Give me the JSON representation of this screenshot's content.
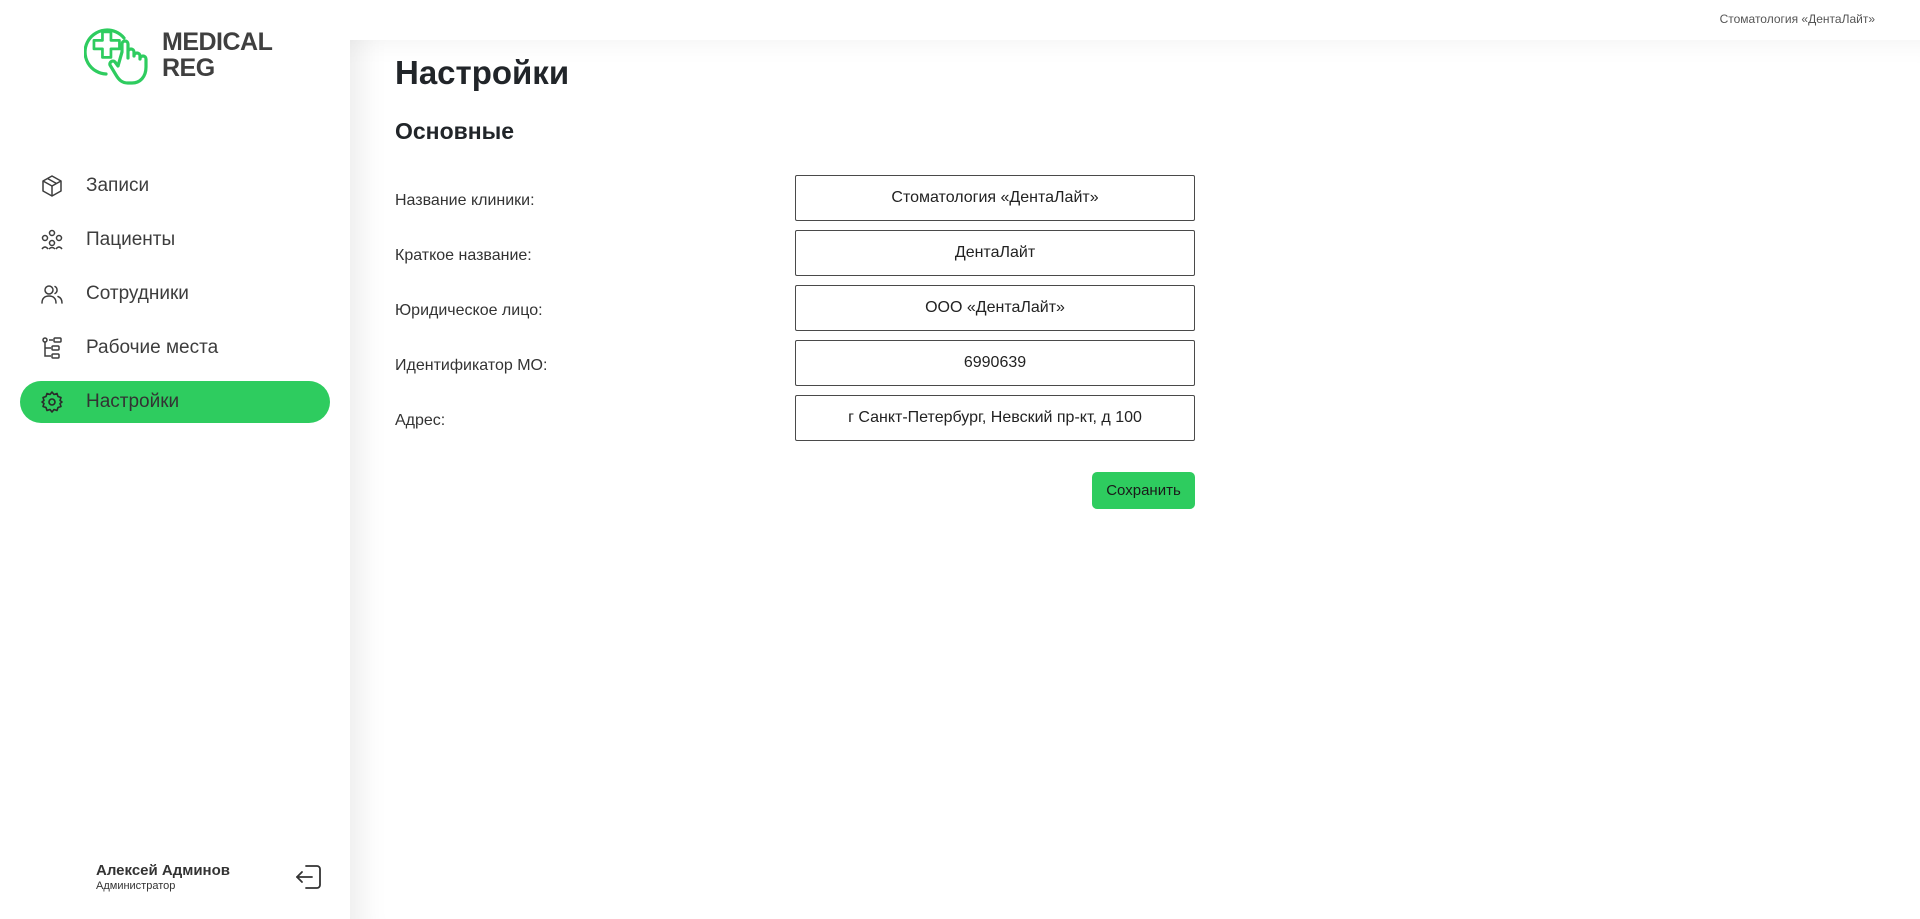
{
  "app": {
    "logo_line1": "MEDICAL",
    "logo_line2": "REG",
    "brand_color": "#2ecc5f"
  },
  "header": {
    "clinic": "Стоматология «ДентаЛайт»"
  },
  "sidebar": {
    "items": [
      {
        "label": "Записи",
        "icon": "box-icon"
      },
      {
        "label": "Пациенты",
        "icon": "patients-icon"
      },
      {
        "label": "Сотрудники",
        "icon": "staff-icon"
      },
      {
        "label": "Рабочие места",
        "icon": "workplaces-icon"
      },
      {
        "label": "Настройки",
        "icon": "gear-icon",
        "active": true
      }
    ]
  },
  "user": {
    "name": "Алексей Админов",
    "role": "Администратор"
  },
  "main": {
    "title": "Настройки",
    "section": "Основные",
    "fields": [
      {
        "label": "Название клиники:",
        "value": "Стоматология «ДентаЛайт»"
      },
      {
        "label": "Краткое название:",
        "value": "ДентаЛайт"
      },
      {
        "label": "Юридическое лицо:",
        "value": "ООО «ДентаЛайт»"
      },
      {
        "label": "Идентификатор МО:",
        "value": "6990639"
      },
      {
        "label": "Адрес:",
        "value": "г Санкт-Петербург, Невский пр-кт, д 100"
      }
    ],
    "save_label": "Сохранить"
  }
}
